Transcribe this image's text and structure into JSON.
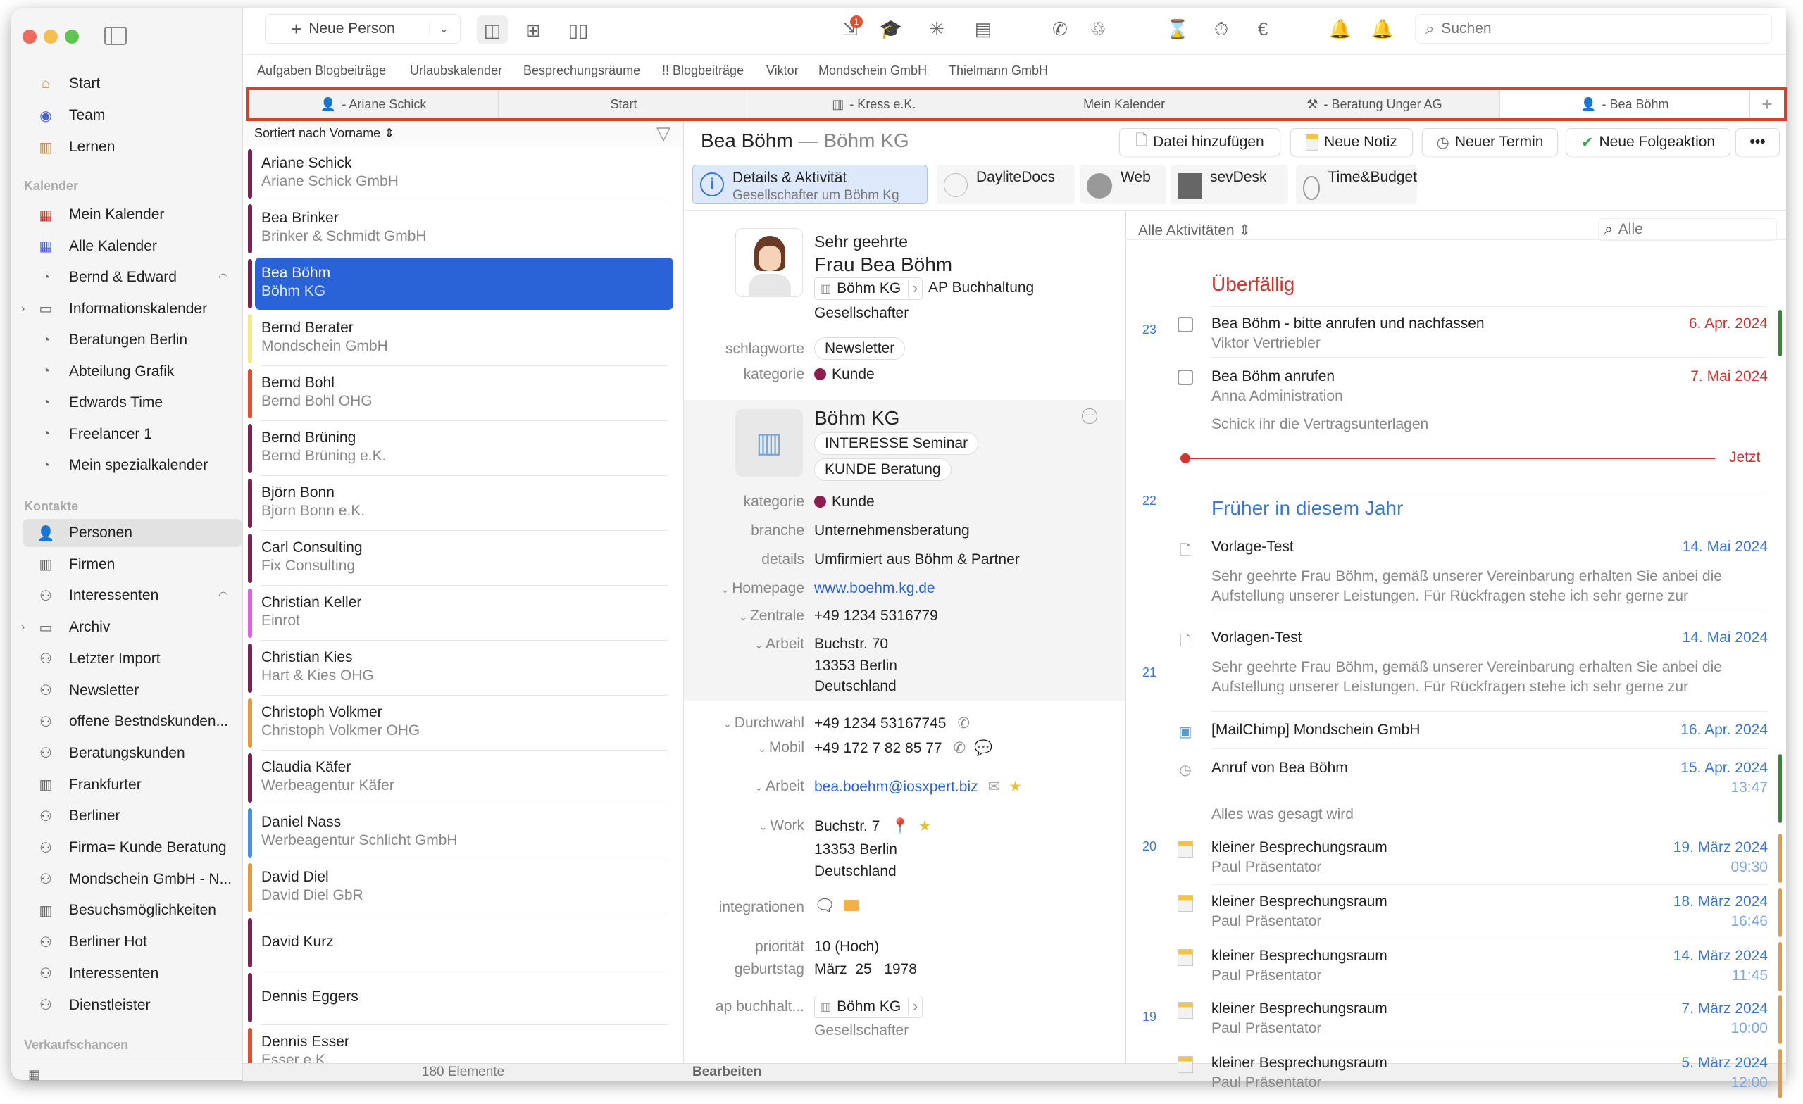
{
  "toolbar": {
    "new_person": "Neue Person",
    "search_placeholder": "Suchen",
    "badge": "1"
  },
  "favorites": [
    "Aufgaben Blogbeiträge",
    "Urlaubskalender",
    "Besprechungsräume",
    "!! Blogbeiträge",
    "Viktor",
    "Mondschein GmbH",
    "Thielmann GmbH"
  ],
  "tabs": [
    {
      "label": "- Ariane Schick",
      "icon": "person"
    },
    {
      "label": "Start",
      "icon": ""
    },
    {
      "label": "- Kress e.K.",
      "icon": "building"
    },
    {
      "label": "Mein Kalender",
      "icon": ""
    },
    {
      "label": "- Beratung Unger AG",
      "icon": "hammer"
    },
    {
      "label": "- Bea Böhm",
      "icon": "person",
      "active": true
    }
  ],
  "sidebar": {
    "top": [
      {
        "label": "Start",
        "icon": "home"
      },
      {
        "label": "Team",
        "icon": "team"
      },
      {
        "label": "Lernen",
        "icon": "books"
      }
    ],
    "kalender_heading": "Kalender",
    "kalender": [
      {
        "label": "Mein Kalender",
        "icon": "calendar-red"
      },
      {
        "label": "Alle Kalender",
        "icon": "calendar-blue"
      },
      {
        "label": "Bernd & Edward",
        "icon": "smart-calendar",
        "sync": true
      },
      {
        "label": "Informationskalender",
        "icon": "folder",
        "expand": true
      },
      {
        "label": "Beratungen Berlin",
        "icon": "list-calendar"
      },
      {
        "label": "Abteilung Grafik",
        "icon": "smart-calendar"
      },
      {
        "label": "Edwards Time",
        "icon": "smart-calendar"
      },
      {
        "label": "Freelancer 1",
        "icon": "smart-calendar"
      },
      {
        "label": "Mein spezialkalender",
        "icon": "smart-calendar"
      }
    ],
    "kontakte_heading": "Kontakte",
    "kontakte": [
      {
        "label": "Personen",
        "icon": "person",
        "selected": true
      },
      {
        "label": "Firmen",
        "icon": "building"
      },
      {
        "label": "Interessenten",
        "icon": "smart-person",
        "sync": true
      },
      {
        "label": "Archiv",
        "icon": "folder",
        "expand": true
      },
      {
        "label": "Letzter Import",
        "icon": "list-person"
      },
      {
        "label": "Newsletter",
        "icon": "smart-person"
      },
      {
        "label": "offene Bestndskunden...",
        "icon": "smart-person"
      },
      {
        "label": "Beratungskunden",
        "icon": "smart-person"
      },
      {
        "label": "Frankfurter",
        "icon": "list-building"
      },
      {
        "label": "Berliner",
        "icon": "list-person"
      },
      {
        "label": "Firma= Kunde Beratung",
        "icon": "smart-person"
      },
      {
        "label": "Mondschein GmbH - N...",
        "icon": "list-person"
      },
      {
        "label": "Besuchsmöglichkeiten",
        "icon": "list-building"
      },
      {
        "label": "Berliner Hot",
        "icon": "smart-person"
      },
      {
        "label": "Interessenten",
        "icon": "smart-person"
      },
      {
        "label": "Dienstleister",
        "icon": "smart-person"
      }
    ],
    "verkauf_heading": "Verkaufschancen"
  },
  "list": {
    "sort_label": "Sortiert nach Vorname",
    "count": "180 Elemente",
    "rows": [
      {
        "name": "Ariane Schick",
        "company": "Ariane Schick GmbH",
        "color": "#7b2350"
      },
      {
        "name": "Bea Brinker",
        "company": "Brinker & Schmidt GmbH",
        "color": "#7b2350"
      },
      {
        "name": "Bea Böhm",
        "company": "Böhm KG",
        "color": "#7b2350",
        "selected": true
      },
      {
        "name": "Bernd Berater",
        "company": "Mondschein GmbH",
        "color": "#f2ec88"
      },
      {
        "name": "Bernd Bohl",
        "company": "Bernd Bohl OHG",
        "color": "#e0502e"
      },
      {
        "name": "Bernd Brüning",
        "company": "Bernd Brüning e.K.",
        "color": "#7b2350"
      },
      {
        "name": "Björn Bonn",
        "company": "Björn Bonn e.K.",
        "color": "#7b2350"
      },
      {
        "name": "Carl Consulting",
        "company": "Fix Consulting",
        "color": "#7b2350"
      },
      {
        "name": "Christian Keller",
        "company": "Einrot",
        "color": "#e060e0"
      },
      {
        "name": "Christian Kies",
        "company": "Hart & Kies OHG",
        "color": "#7b2350"
      },
      {
        "name": "Christoph Volkmer",
        "company": "Christoph Volkmer OHG",
        "color": "#e8993f"
      },
      {
        "name": "Claudia Käfer",
        "company": "Werbeagentur Käfer",
        "color": "#7b2350"
      },
      {
        "name": "Daniel Nass",
        "company": "Werbeagentur Schlicht GmbH",
        "color": "#4a90e2"
      },
      {
        "name": "David Diel",
        "company": "David Diel GbR",
        "color": "#e8993f"
      },
      {
        "name": "David Kurz",
        "company": "",
        "color": "#7b2350"
      },
      {
        "name": "Dennis Eggers",
        "company": "",
        "color": "#7b2350"
      },
      {
        "name": "Dennis Esser",
        "company": "Esser e.K.",
        "color": "#e0502e"
      }
    ]
  },
  "detail": {
    "name": "Bea Böhm",
    "separator": " — ",
    "company": "Böhm KG",
    "buttons": [
      "Datei hinzufügen",
      "Neue Notiz",
      "Neuer Termin",
      "Neue Folgeaktion"
    ],
    "plugin_tabs": [
      {
        "title": "Details & Aktivität",
        "subtitle": "Gesellschafter um Böhm Kg",
        "active": true
      },
      {
        "title": "DayliteDocs"
      },
      {
        "title": "Web"
      },
      {
        "title": "sevDesk"
      },
      {
        "title": "Time&Budget"
      }
    ],
    "salutation": "Sehr geehrte",
    "full_name": "Frau Bea Böhm",
    "company_chip": "Böhm KG",
    "department": "AP Buchhaltung",
    "role": "Gesellschafter",
    "schlagworte_label": "schlagworte",
    "schlagwort": "Newsletter",
    "kategorie_label": "kategorie",
    "kategorie": "Kunde",
    "kategorie_color": "#8b1e4f",
    "firm": {
      "name": "Böhm KG",
      "tags": [
        "INTERESSE Seminar",
        "KUNDE Beratung"
      ],
      "kategorie": "Kunde",
      "branche_label": "branche",
      "branche": "Unternehmensberatung",
      "details_label": "details",
      "details": "Umfirmiert aus Böhm & Partner",
      "homepage_label": "Homepage",
      "homepage": "www.boehm.kg.de",
      "zentrale_label": "Zentrale",
      "zentrale": "+49 1234 5316779",
      "arbeit_label": "Arbeit",
      "address": [
        "Buchstr. 70",
        "13353 Berlin",
        "Deutschland"
      ]
    },
    "durchwahl_label": "Durchwahl",
    "durchwahl": "+49 1234 53167745",
    "mobil_label": "Mobil",
    "mobil": "+49 172 7 82 85 77",
    "email_label": "Arbeit",
    "email": "bea.boehm@iosxpert.biz",
    "work_label": "Work",
    "work_address": [
      "Buchstr. 7",
      "13353 Berlin",
      "Deutschland"
    ],
    "integrationen_label": "integrationen",
    "prioritaet_label": "priorität",
    "prioritaet": "10 (Hoch)",
    "geburtstag_label": "geburtstag",
    "geburtstag": "März  25   1978",
    "ap_label": "ap buchhalt...",
    "ap_chip": "Böhm KG",
    "ap_role": "Gesellschafter",
    "edit": "Bearbeiten"
  },
  "activities": {
    "filter": "Alle Aktivitäten",
    "search_placeholder": "Alle",
    "overdue_heading": "Überfällig",
    "now_label": "Jetzt",
    "earlier_heading": "Früher in diesem Jahr",
    "weeks": [
      "23",
      "22",
      "21",
      "20",
      "19"
    ],
    "colors": {
      "overdue": "#d0342c",
      "date": "#3a78d8"
    },
    "items": [
      {
        "type": "task",
        "title": "Bea Böhm - bitte anrufen und nachfassen",
        "sub": "Viktor Vertriebler",
        "date": "6. Apr. 2024",
        "overdue": true,
        "bar": "#2e8b2e"
      },
      {
        "type": "task",
        "title": "Bea Böhm anrufen",
        "sub": "Anna Administration",
        "note": "Schick ihr die Vertragsunterlagen",
        "date": "7. Mai 2024",
        "overdue": true
      },
      {
        "type": "doc",
        "title": "Vorlage-Test",
        "body": [
          "Sehr geehrte Frau Böhm, gemäß unserer Vereinbarung erhalten Sie anbei die",
          "Aufstellung unserer Leistungen. Für Rückfragen stehe ich sehr gerne zur"
        ],
        "date": "14. Mai 2024"
      },
      {
        "type": "doc",
        "title": "Vorlagen-Test",
        "body": [
          "Sehr geehrte Frau Böhm, gemäß unserer Vereinbarung erhalten Sie anbei die",
          "Aufstellung unserer Leistungen. Für Rückfragen stehe ich sehr gerne zur"
        ],
        "date": "14. Mai 2024"
      },
      {
        "type": "mail",
        "title": "[MailChimp] Mondschein GmbH",
        "date": "16. Apr. 2024"
      },
      {
        "type": "call",
        "title": "Anruf von Bea Böhm",
        "note": "Alles was gesagt wird",
        "date": "15. Apr. 2024",
        "time": "13:47",
        "bar": "#2e8b2e"
      },
      {
        "type": "note",
        "title": "kleiner Besprechungsraum",
        "sub": "Paul Präsentator",
        "date": "19. März 2024",
        "time": "09:30",
        "bar": "#e8993f"
      },
      {
        "type": "note",
        "title": "kleiner Besprechungsraum",
        "sub": "Paul Präsentator",
        "date": "18. März 2024",
        "time": "16:46",
        "bar": "#e8993f"
      },
      {
        "type": "note",
        "title": "kleiner Besprechungsraum",
        "sub": "Paul Präsentator",
        "date": "14. März 2024",
        "time": "11:45",
        "bar": "#e8993f"
      },
      {
        "type": "note",
        "title": "kleiner Besprechungsraum",
        "sub": "Paul Präsentator",
        "date": "7. März 2024",
        "time": "10:00",
        "bar": "#e8993f"
      },
      {
        "type": "note",
        "title": "kleiner Besprechungsraum",
        "sub": "Paul Präsentator",
        "date": "5. März 2024",
        "time": "12:00",
        "bar": "#e8993f"
      }
    ]
  }
}
